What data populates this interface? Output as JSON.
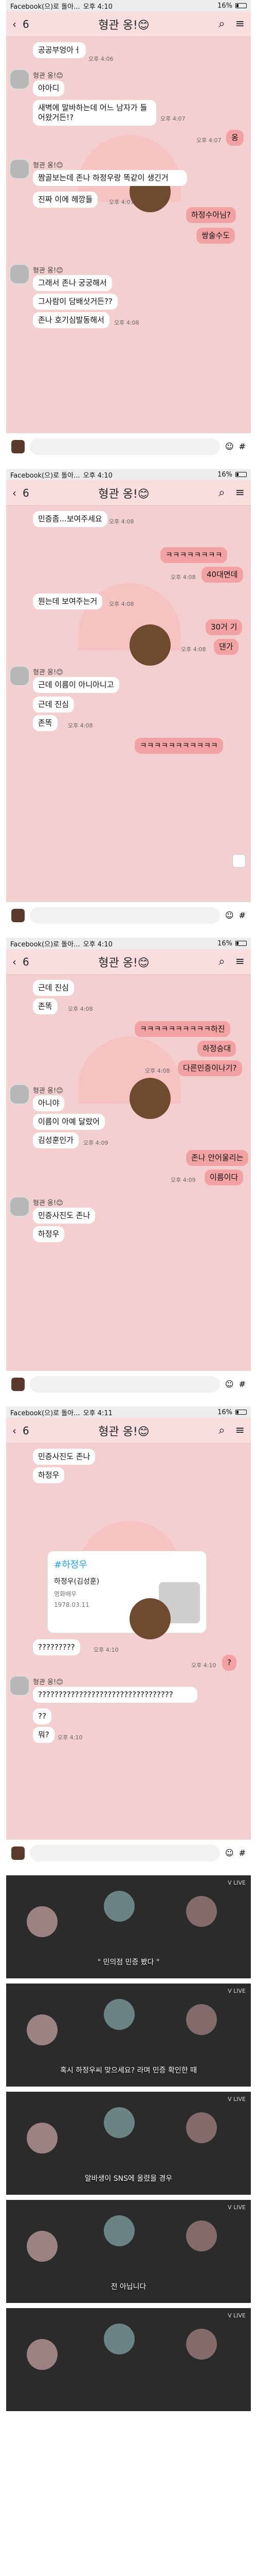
{
  "status": {
    "app": "Facebook(으)로 돌아...",
    "time_1": "오후 4:10",
    "time_2": "오후 4:10",
    "time_3": "오후 4:10",
    "time_4": "오후 4:11",
    "battery": "16%"
  },
  "chat_title": "형관 옹!😊",
  "back_count": "6",
  "screens": [
    {
      "messages": [
        {
          "dir": "in",
          "text": "공공부엉아ㅓ",
          "time": "오후 4:06"
        },
        {
          "dir": "in",
          "name": "형관 옹!😊",
          "text": "야아디",
          "time": ""
        },
        {
          "dir": "in",
          "text": "새벽에 말바하는데 어느 남자가 들어왔거든!?",
          "time": "오후 4:07"
        },
        {
          "dir": "out",
          "text": "옹",
          "time": "오후 4:07"
        },
        {
          "dir": "in",
          "name": "형관 옹!😊",
          "text": "짬골보는데 존나 하정우랑 똑같이 생긴거",
          "time": ""
        },
        {
          "dir": "in",
          "text": "진짜 이에 헤깡들",
          "time": "오후 4:07"
        },
        {
          "dir": "out",
          "text": "하정수아님?",
          "time": ""
        },
        {
          "dir": "out",
          "text": "쌍술수도",
          "time": ""
        },
        {
          "dir": "in",
          "name": "형관 옹!😊",
          "text": "그래서 존나 궁궁해서",
          "time": ""
        },
        {
          "dir": "in",
          "text": "그사람이 담배삿거든??",
          "time": ""
        },
        {
          "dir": "in",
          "text": "존나 호기심발동해서",
          "time": "오후 4:08"
        }
      ]
    },
    {
      "messages": [
        {
          "dir": "in",
          "text": "민증좀...보여주세요",
          "time": "오후 4:08"
        },
        {
          "dir": "out",
          "text": "ㅋㅋㅋㅋㅋㅋㅋㅋ",
          "time": ""
        },
        {
          "dir": "out",
          "text": "40대면데",
          "time": "오후 4:08"
        },
        {
          "dir": "in",
          "text": "뭔는데 보여주는거",
          "time": "오후 4:08"
        },
        {
          "dir": "out",
          "text": "30거 기",
          "time": ""
        },
        {
          "dir": "out",
          "text": "댄가",
          "time": "오후 4:08"
        },
        {
          "dir": "in",
          "name": "형관 옹!😊",
          "text": "근데 이름이 아니아니고",
          "time": ""
        },
        {
          "dir": "in",
          "text": "근데 진심",
          "time": ""
        },
        {
          "dir": "in",
          "text": "존똑",
          "time": "오후 4:08"
        },
        {
          "dir": "out",
          "text": "ㅋㅋㅋㅋㅋㅋㅋㅋㅋㅋㅋ",
          "time": ""
        }
      ]
    },
    {
      "messages": [
        {
          "dir": "in",
          "text": "근데 진심",
          "time": ""
        },
        {
          "dir": "in",
          "text": "존똑",
          "time": "오후 4:08"
        },
        {
          "dir": "out",
          "text": "ㅋㅋㅋㅋㅋㅋㅋㅋㅋㅋ하진",
          "time": ""
        },
        {
          "dir": "out",
          "text": "하정승대",
          "time": ""
        },
        {
          "dir": "out",
          "text": "다른민증이나기?",
          "time": "오후 4:08"
        },
        {
          "dir": "in",
          "name": "형관 옹!😊",
          "text": "아니야",
          "time": ""
        },
        {
          "dir": "in",
          "text": "이름이 아예 달랐어",
          "time": ""
        },
        {
          "dir": "in",
          "text": "김성훈인가",
          "time": "오후 4:09"
        },
        {
          "dir": "out",
          "text": "존나 안어울리는",
          "time": ""
        },
        {
          "dir": "out",
          "text": "이름이다",
          "time": "오후 4:09"
        },
        {
          "dir": "in",
          "name": "형관 옹!😊",
          "text": "민증사진도 존나",
          "time": ""
        },
        {
          "dir": "in",
          "text": "하정우",
          "time": ""
        }
      ]
    },
    {
      "messages": [
        {
          "dir": "in",
          "text": "민증사진도 존나",
          "time": ""
        },
        {
          "dir": "in",
          "text": "하정우",
          "time": ""
        },
        {
          "dir": "in",
          "text": "?????????",
          "time": "오후 4:10"
        },
        {
          "dir": "out",
          "text": "?",
          "time": "오후 4:10"
        },
        {
          "dir": "in",
          "name": "형관 옹!😊",
          "text": "?????????????????????????????????",
          "time": ""
        },
        {
          "dir": "in",
          "text": "??",
          "time": ""
        },
        {
          "dir": "in",
          "text": "뭐?",
          "time": "오후 4:10"
        }
      ],
      "card": {
        "hashtag": "#하정우",
        "name": "하정우(김성훈)",
        "job": "영화배우",
        "dob": "1978.03.11"
      }
    }
  ],
  "videos": [
    {
      "caption": "\" 민의점 민증 봤다 \"",
      "logo": "V LIVE"
    },
    {
      "caption": "혹시 하정우씨 맞으세요? 라며 민증 확인한 때",
      "logo": "V LIVE"
    },
    {
      "caption": "알바생이 SNS에 올렸을 경우",
      "logo": "V LIVE"
    },
    {
      "caption": "전 아닙니다",
      "logo": "V LIVE"
    },
    {
      "caption": "",
      "logo": "V LIVE"
    }
  ],
  "colors": {
    "chat_bg": "#f4cfcf",
    "outgoing": "#f2a2a2",
    "incoming": "#ffffff"
  }
}
